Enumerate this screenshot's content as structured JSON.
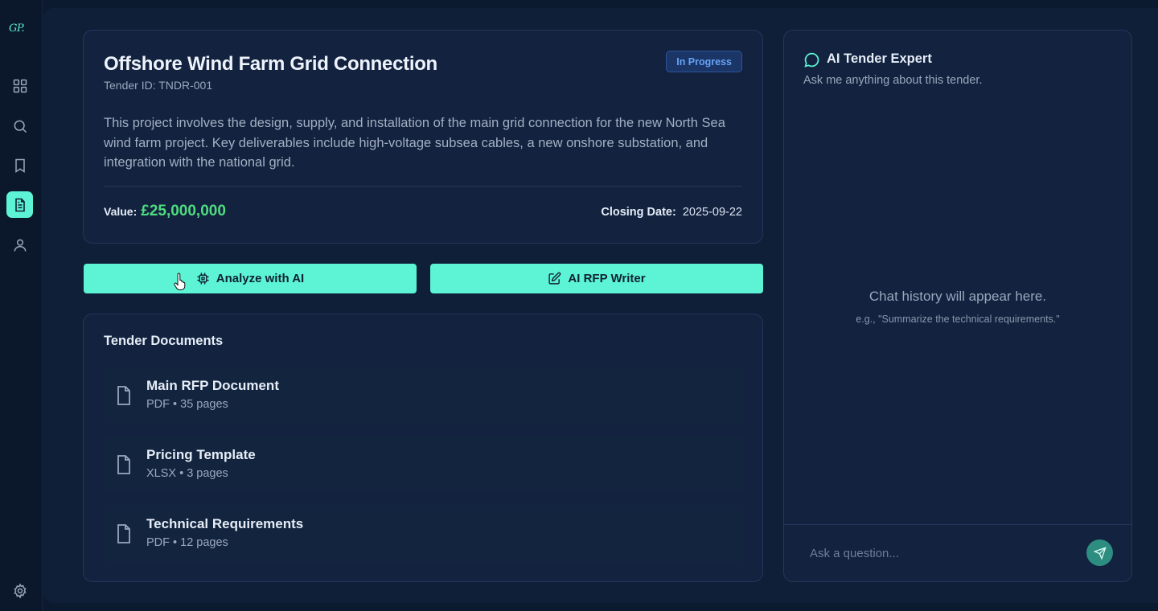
{
  "app": {
    "logo": "GP."
  },
  "sidebar": {
    "items": [
      {
        "name": "dashboard",
        "icon": "grid-icon",
        "active": false
      },
      {
        "name": "search",
        "icon": "search-icon",
        "active": false
      },
      {
        "name": "saved",
        "icon": "bookmark-icon",
        "active": false
      },
      {
        "name": "tenders",
        "icon": "document-icon",
        "active": true
      },
      {
        "name": "profile",
        "icon": "user-icon",
        "active": false
      }
    ],
    "footer_icon": "gear-icon"
  },
  "tender": {
    "title": "Offshore Wind Farm Grid Connection",
    "id_text": "Tender ID: TNDR-001",
    "status": "In Progress",
    "description": "This project involves the design, supply, and installation of the main grid connection for the new North Sea wind farm project. Key deliverables include high-voltage subsea cables, a new onshore substation, and integration with the national grid.",
    "value_label": "Value:",
    "value": "£25,000,000",
    "closing_label": "Closing Date:",
    "closing_date": "2025-09-22"
  },
  "actions": {
    "analyze_label": "Analyze with AI",
    "rfp_label": "AI RFP Writer"
  },
  "documents": {
    "title": "Tender Documents",
    "items": [
      {
        "name": "Main RFP Document",
        "meta": "PDF • 35 pages"
      },
      {
        "name": "Pricing Template",
        "meta": "XLSX • 3 pages"
      },
      {
        "name": "Technical Requirements",
        "meta": "PDF • 12 pages"
      }
    ]
  },
  "chat": {
    "title": "AI Tender Expert",
    "subtitle": "Ask me anything about this tender.",
    "empty_text": "Chat history will appear here.",
    "example_text": "e.g., \"Summarize the technical requirements.\"",
    "input_placeholder": "Ask a question..."
  },
  "colors": {
    "accent": "#5cf4d5",
    "value_green": "#4fdc7f",
    "status_blue": "#67a3f5",
    "background": "#0c1a30"
  }
}
